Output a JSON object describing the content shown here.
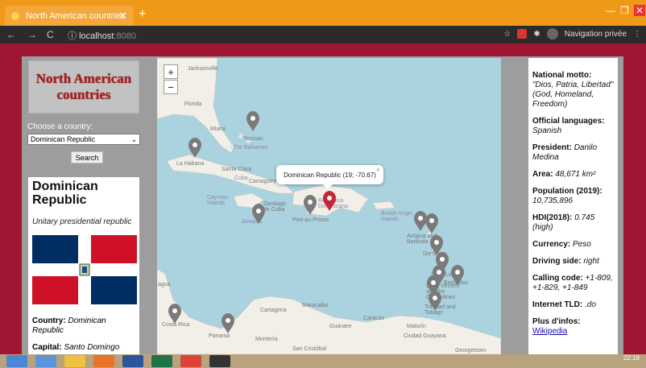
{
  "browser": {
    "tab_title": "North American countries",
    "url_host": "localhost",
    "url_port": ":8080",
    "incognito_label": "Navigation privée"
  },
  "left": {
    "title": "North American countries",
    "choose_label": "Choose a country:",
    "selected_country": "Dominican Republic",
    "search_button": "Search"
  },
  "card": {
    "name": "Dominican Republic",
    "government": "Unitary presidential republic",
    "country_label": "Country:",
    "country_value": "Dominican Republic",
    "capital_label": "Capital:",
    "capital_value": "Santo Domingo"
  },
  "map": {
    "zoom_in": "+",
    "zoom_out": "−",
    "popup_text": "Dominican Republic (19; -70.67)",
    "popup_close": "×",
    "labels": [
      "Jacksonville",
      "Florida",
      "Miami",
      "Nassau",
      "The Bahamas",
      "La Habana",
      "Santa Clara",
      "Cuba",
      "Camagüey",
      "Cayman Islands",
      "Santiago de Cuba",
      "Jamaica",
      "Port-au-Prince",
      "República Dominicana",
      "British Virgin Islands",
      "Antigua and Barbuda",
      "Dominica",
      "Saint Lucia",
      "Barbados",
      "Saint Vincent and the Grenadines",
      "Trinidad and Tobago",
      "Cartagena",
      "Maracaibo",
      "Caracas",
      "Guanare",
      "Maturín",
      "Ciudad Guayana",
      "Costa Rica",
      "Panamá",
      "Montería",
      "San Cristóbal",
      "Georgetown",
      "agua"
    ]
  },
  "info": {
    "motto_label": "National motto:",
    "motto_value": "\"Dios, Patria, Libertad\" (God, Homeland, Freedom)",
    "languages_label": "Official languages:",
    "languages_value": "Spanish",
    "president_label": "President:",
    "president_value": "Danilo Medina",
    "area_label": "Area:",
    "area_value": "48,671 km²",
    "population_label": "Population (2019):",
    "population_value": "10,735,896",
    "hdi_label": "HDI(2018):",
    "hdi_value": "0.745 (high)",
    "currency_label": "Currency:",
    "currency_value": "Peso",
    "driving_label": "Driving side:",
    "driving_value": "right",
    "calling_label": "Calling code:",
    "calling_value": "+1-809, +1-829, +1-849",
    "tld_label": "Internet TLD:",
    "tld_value": ".do",
    "more_label": "Plus d'infos:",
    "more_link": "Wikipedia"
  },
  "taskbar": {
    "time": "22:19"
  },
  "colors": {
    "page_bg": "#9e1631",
    "title_red": "#a51f1f",
    "sea": "#aad3df",
    "land": "#f2efe9",
    "active_marker": "#c9243a",
    "marker": "#7a7a7a"
  }
}
